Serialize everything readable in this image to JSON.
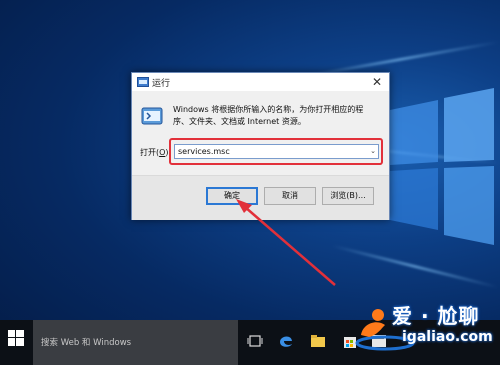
{
  "dialog": {
    "title": "运行",
    "close_glyph": "✕",
    "description": "Windows 将根据你所输入的名称，为你打开相应的程序、文件夹、文档或 Internet 资源。",
    "open_label_prefix": "打开(",
    "open_label_key": "O",
    "open_label_suffix": "):",
    "open_value": "services.msc",
    "dropdown_glyph": "⌄",
    "ok_label": "确定",
    "cancel_label": "取消",
    "browse_label": "浏览(B)..."
  },
  "taskbar": {
    "search_placeholder": "搜索 Web 和 Windows",
    "icons": [
      "windows-start-icon",
      "task-view-icon",
      "edge-icon",
      "file-explorer-icon",
      "store-icon",
      "app-icon"
    ]
  },
  "watermark": {
    "text_cn": "爱 · 尬聊",
    "url": "igaliao.com"
  },
  "colors": {
    "highlight": "#e2303a",
    "accent": "#2b78d4"
  }
}
